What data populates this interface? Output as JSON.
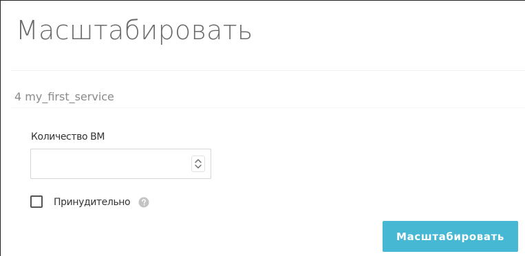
{
  "dialog": {
    "title": "Масштабировать",
    "service_label": "4 my_first_service"
  },
  "form": {
    "vm_count": {
      "label": "Количество ВМ",
      "value": "",
      "placeholder": ""
    },
    "force": {
      "label": "Принудительно",
      "checked": false
    },
    "submit_label": "Масштабировать"
  },
  "icons": {
    "stepper": "stepper-arrows-icon",
    "help": "question-circle-icon"
  },
  "colors": {
    "accent": "#47b8d4",
    "title_text": "#6b6b6b",
    "subtitle_text": "#8a8a8a"
  }
}
